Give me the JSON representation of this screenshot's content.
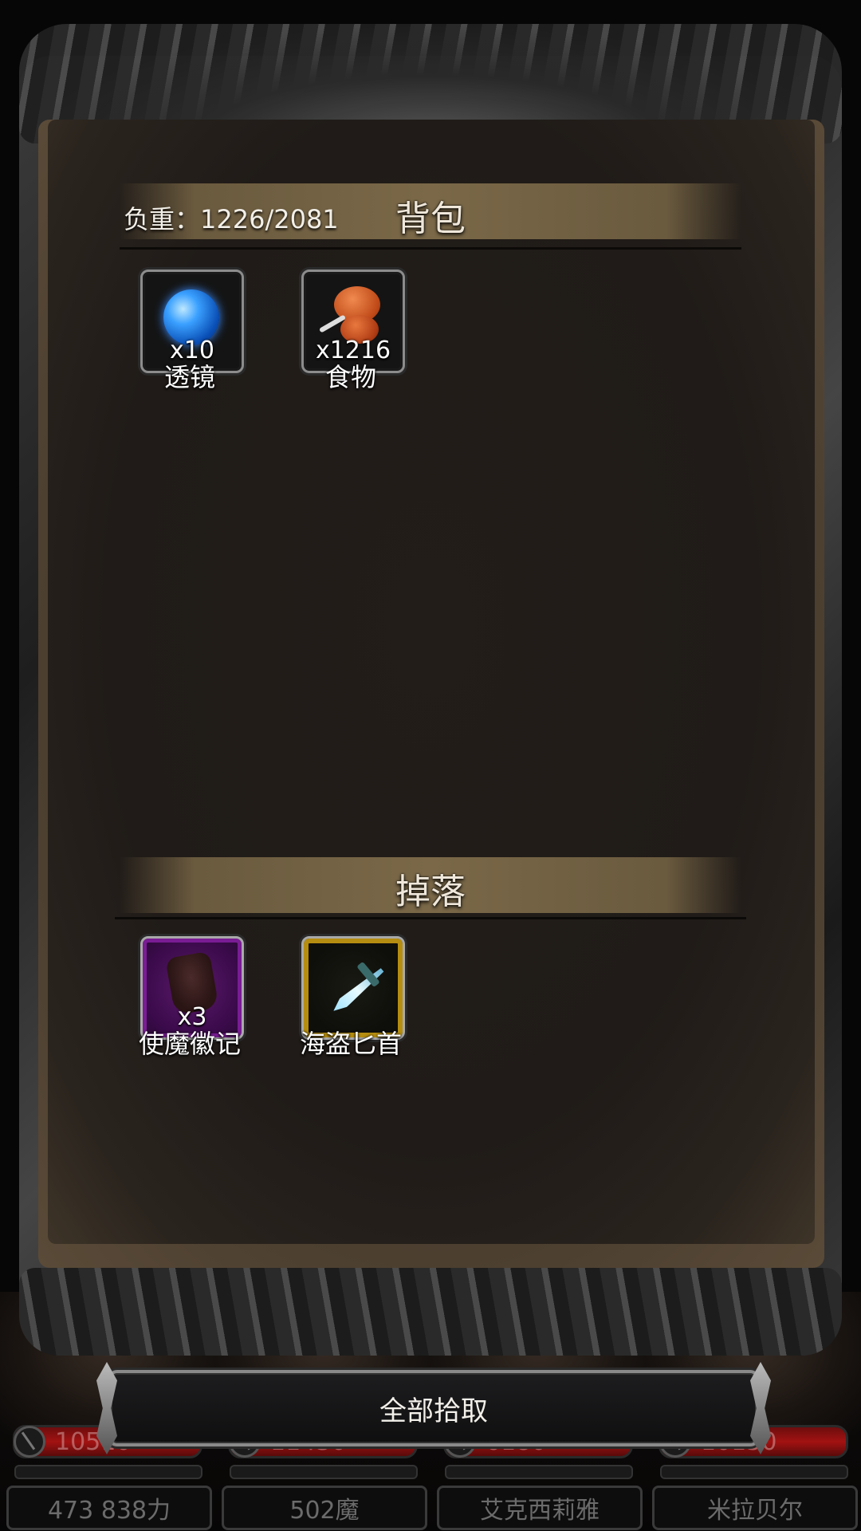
{
  "inventory": {
    "weight_label": "负重：1226/2081",
    "title": "背包",
    "items": [
      {
        "name": "透镜",
        "qty": "x10",
        "icon": "lens-icon"
      },
      {
        "name": "食物",
        "qty": "x1216",
        "icon": "meat-icon"
      }
    ]
  },
  "drops": {
    "title": "掉落",
    "items": [
      {
        "name": "使魔徽记",
        "qty": "x3",
        "icon": "emblem-icon",
        "rarity_color": "#7a1c94"
      },
      {
        "name": "海盗匕首",
        "qty": "",
        "icon": "dagger-icon",
        "rarity_color": "#b58d10"
      }
    ]
  },
  "pickup_all_label": "全部拾取",
  "party": [
    {
      "hp": "10510",
      "name": "473 838力"
    },
    {
      "hp": "11430",
      "name": "502魔"
    },
    {
      "hp": "6180",
      "name": "艾克西莉雅"
    },
    {
      "hp": "10150",
      "name": "米拉贝尔"
    }
  ],
  "colors": {
    "hp_bar": "#a31212",
    "panel_bg": "#201b18",
    "header_bg": "#7a6848"
  }
}
